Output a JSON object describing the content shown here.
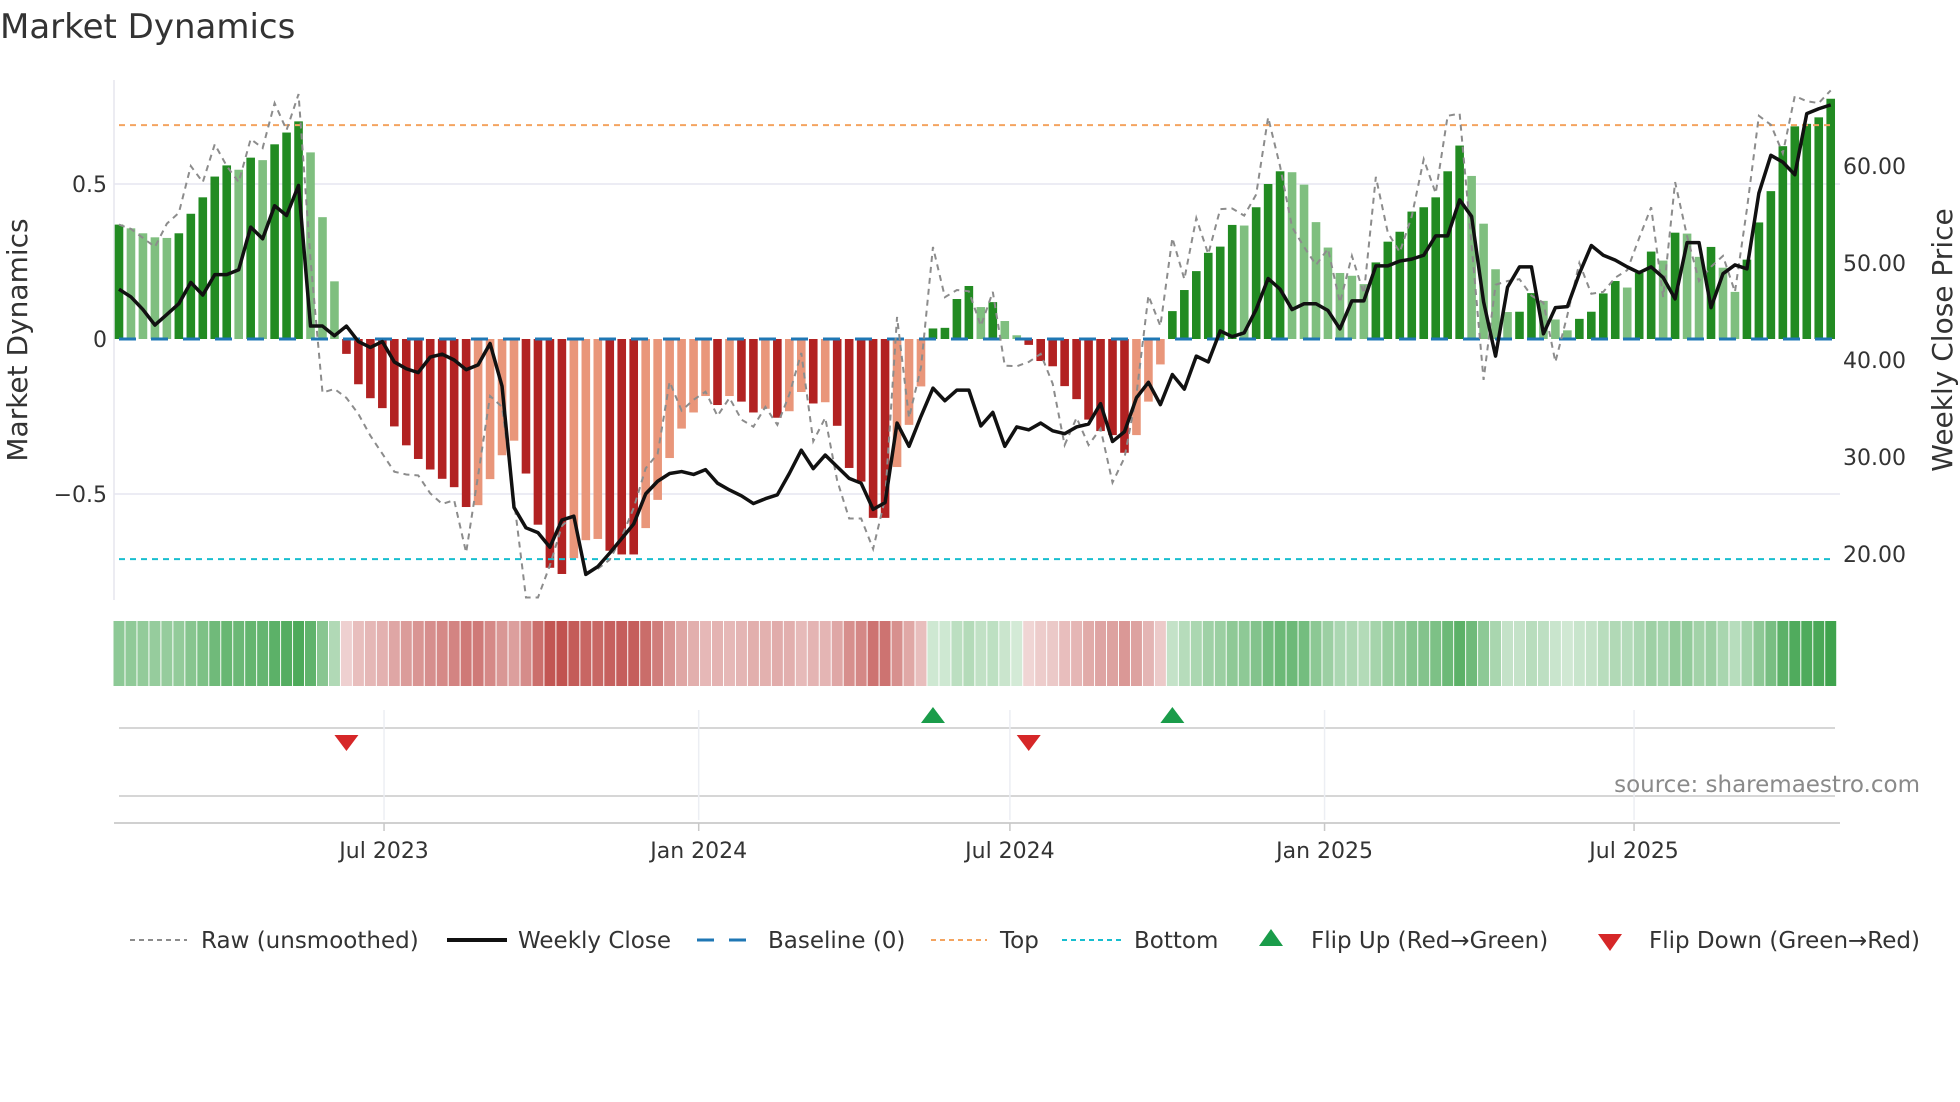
{
  "title": "Market Dynamics",
  "source": "source: sharemaestro.com",
  "chart_data": {
    "type": "bar",
    "title": "Market Dynamics",
    "xlabel": "",
    "ylabel": "Market Dynamics",
    "y2label": "Weekly Close Price",
    "start_date": "2023-01-27",
    "frequency": "weekly",
    "ylim": [
      -0.85,
      0.82
    ],
    "y2lim": [
      15.0,
      67.5
    ],
    "yticks": [
      {
        "value": 0.5,
        "label": "0.5"
      },
      {
        "value": 0,
        "label": "0"
      },
      {
        "value": -0.5,
        "label": "−0.5"
      }
    ],
    "y2ticks": [
      {
        "value": 60,
        "label": "60.00"
      },
      {
        "value": 50,
        "label": "50.00"
      },
      {
        "value": 40,
        "label": "40.00"
      },
      {
        "value": 30,
        "label": "30.00"
      },
      {
        "value": 20,
        "label": "20.00"
      }
    ],
    "xticks": [
      {
        "date": "2023-07-01",
        "label": "Jul 2023"
      },
      {
        "date": "2024-01-01",
        "label": "Jan 2024"
      },
      {
        "date": "2024-07-01",
        "label": "Jul 2024"
      },
      {
        "date": "2025-01-01",
        "label": "Jan 2025"
      },
      {
        "date": "2025-07-01",
        "label": "Jul 2025"
      }
    ],
    "top": 0.69,
    "bottom": -0.71,
    "baseline": 0,
    "grid": true,
    "legend_placement": "bottom",
    "colors": {
      "up_strong": "#228b22",
      "up_weak": "#7fbf7f",
      "down_strong": "#b22222",
      "down_weak": "#e9967a",
      "raw": "#8c8c8c",
      "close": "#111111",
      "baseline": "#1f77b4",
      "top": "#f4a460",
      "bottom": "#17becf",
      "flip_up": "#1a9c4a",
      "flip_down": "#d62728",
      "strip_green": "#3fa34d",
      "strip_red": "#c0504d"
    },
    "momentum": [
      0.369,
      0.357,
      0.341,
      0.328,
      0.326,
      0.341,
      0.404,
      0.457,
      0.524,
      0.56,
      0.546,
      0.585,
      0.577,
      0.628,
      0.666,
      0.702,
      0.602,
      0.393,
      0.186,
      -0.048,
      -0.146,
      -0.191,
      -0.223,
      -0.282,
      -0.343,
      -0.387,
      -0.421,
      -0.451,
      -0.478,
      -0.542,
      -0.536,
      -0.452,
      -0.375,
      -0.328,
      -0.434,
      -0.599,
      -0.738,
      -0.758,
      -0.707,
      -0.649,
      -0.645,
      -0.683,
      -0.695,
      -0.695,
      -0.61,
      -0.519,
      -0.384,
      -0.289,
      -0.237,
      -0.184,
      -0.213,
      -0.184,
      -0.202,
      -0.237,
      -0.225,
      -0.254,
      -0.233,
      -0.171,
      -0.208,
      -0.204,
      -0.28,
      -0.416,
      -0.46,
      -0.577,
      -0.577,
      -0.413,
      -0.277,
      -0.153,
      0.034,
      0.036,
      0.129,
      0.171,
      0.103,
      0.119,
      0.058,
      0.012,
      -0.019,
      -0.071,
      -0.088,
      -0.152,
      -0.194,
      -0.26,
      -0.297,
      -0.31,
      -0.367,
      -0.31,
      -0.202,
      -0.082,
      0.09,
      0.158,
      0.219,
      0.278,
      0.298,
      0.368,
      0.366,
      0.425,
      0.5,
      0.541,
      0.538,
      0.498,
      0.377,
      0.295,
      0.213,
      0.204,
      0.177,
      0.247,
      0.314,
      0.346,
      0.411,
      0.425,
      0.457,
      0.541,
      0.624,
      0.526,
      0.372,
      0.225,
      0.087,
      0.088,
      0.148,
      0.123,
      0.063,
      0.028,
      0.065,
      0.088,
      0.147,
      0.187,
      0.166,
      0.213,
      0.282,
      0.253,
      0.343,
      0.34,
      0.265,
      0.297,
      0.23,
      0.152,
      0.256,
      0.376,
      0.477,
      0.622,
      0.686,
      0.694,
      0.715,
      0.775
    ],
    "raw": [
      0.369,
      0.355,
      0.326,
      0.297,
      0.372,
      0.407,
      0.558,
      0.506,
      0.628,
      0.558,
      0.506,
      0.645,
      0.616,
      0.761,
      0.674,
      0.79,
      0.256,
      -0.173,
      -0.161,
      -0.19,
      -0.242,
      -0.312,
      -0.37,
      -0.428,
      -0.437,
      -0.44,
      -0.498,
      -0.532,
      -0.52,
      -0.689,
      -0.44,
      -0.184,
      -0.219,
      -0.52,
      -0.834,
      -0.834,
      -0.73,
      -0.603,
      -0.568,
      -0.753,
      -0.741,
      -0.712,
      -0.638,
      -0.545,
      -0.417,
      -0.37,
      -0.138,
      -0.231,
      -0.196,
      -0.17,
      -0.248,
      -0.19,
      -0.26,
      -0.283,
      -0.219,
      -0.277,
      -0.179,
      -0.045,
      -0.33,
      -0.254,
      -0.457,
      -0.579,
      -0.579,
      -0.677,
      -0.515,
      0.071,
      -0.254,
      -0.092,
      0.297,
      0.135,
      0.158,
      0.154,
      0.042,
      0.152,
      -0.086,
      -0.088,
      -0.074,
      -0.048,
      -0.144,
      -0.342,
      -0.254,
      -0.342,
      -0.289,
      -0.463,
      -0.383,
      -0.179,
      0.14,
      0.042,
      0.326,
      0.193,
      0.39,
      0.274,
      0.419,
      0.421,
      0.398,
      0.466,
      0.715,
      0.557,
      0.361,
      0.297,
      0.239,
      0.291,
      0.117,
      0.268,
      0.146,
      0.523,
      0.343,
      0.28,
      0.396,
      0.58,
      0.47,
      0.72,
      0.727,
      0.303,
      -0.132,
      0.175,
      0.187,
      0.193,
      0.14,
      0.117,
      -0.074,
      0.077,
      0.245,
      0.146,
      0.152,
      0.198,
      0.222,
      0.326,
      0.425,
      0.135,
      0.506,
      0.332,
      0.187,
      0.233,
      0.268,
      0.152,
      0.419,
      0.72,
      0.691,
      0.599,
      0.784,
      0.767,
      0.761,
      0.802
    ],
    "close": [
      47.3,
      46.5,
      45.2,
      43.6,
      44.7,
      45.8,
      48.0,
      46.7,
      48.8,
      48.8,
      49.3,
      53.7,
      52.5,
      55.9,
      54.9,
      58.0,
      43.5,
      43.5,
      42.5,
      43.5,
      41.9,
      41.3,
      41.9,
      39.8,
      39.1,
      38.7,
      40.3,
      40.6,
      40.0,
      39.0,
      39.5,
      41.7,
      37.3,
      24.8,
      22.7,
      22.2,
      20.7,
      23.5,
      23.9,
      17.9,
      18.7,
      20.1,
      21.6,
      23.1,
      26.2,
      27.5,
      28.3,
      28.5,
      28.2,
      28.7,
      27.3,
      26.6,
      26.0,
      25.2,
      25.7,
      26.1,
      28.3,
      30.7,
      28.8,
      30.2,
      29.0,
      27.8,
      27.3,
      24.6,
      25.3,
      33.5,
      31.1,
      34.2,
      37.1,
      35.8,
      36.9,
      36.9,
      33.2,
      34.6,
      31.1,
      33.1,
      32.8,
      33.5,
      32.7,
      32.4,
      33.1,
      33.4,
      35.5,
      31.6,
      32.6,
      36.1,
      37.7,
      35.4,
      38.5,
      37.0,
      40.4,
      39.8,
      43.0,
      42.4,
      42.8,
      45.2,
      48.4,
      47.3,
      45.2,
      45.8,
      45.8,
      45.1,
      43.2,
      46.1,
      46.1,
      49.7,
      49.7,
      50.2,
      50.4,
      50.8,
      52.8,
      52.8,
      56.5,
      54.8,
      46.0,
      40.4,
      47.5,
      49.6,
      49.6,
      42.7,
      45.4,
      45.5,
      48.9,
      51.8,
      50.8,
      50.3,
      49.6,
      49.0,
      49.6,
      48.5,
      46.3,
      52.1,
      52.1,
      45.4,
      48.9,
      49.8,
      49.4,
      57.2,
      61.1,
      60.4,
      59.1,
      65.4,
      65.9,
      66.3
    ],
    "legend": [
      {
        "key": "raw",
        "label": "Raw (unsmoothed)"
      },
      {
        "key": "close",
        "label": "Weekly Close"
      },
      {
        "key": "baseline",
        "label": "Baseline (0)"
      },
      {
        "key": "top",
        "label": "Top"
      },
      {
        "key": "bottom",
        "label": "Bottom"
      },
      {
        "key": "flip_up",
        "label": "Flip Up (Red→Green)"
      },
      {
        "key": "flip_down",
        "label": "Flip Down (Green→Red)"
      }
    ]
  }
}
